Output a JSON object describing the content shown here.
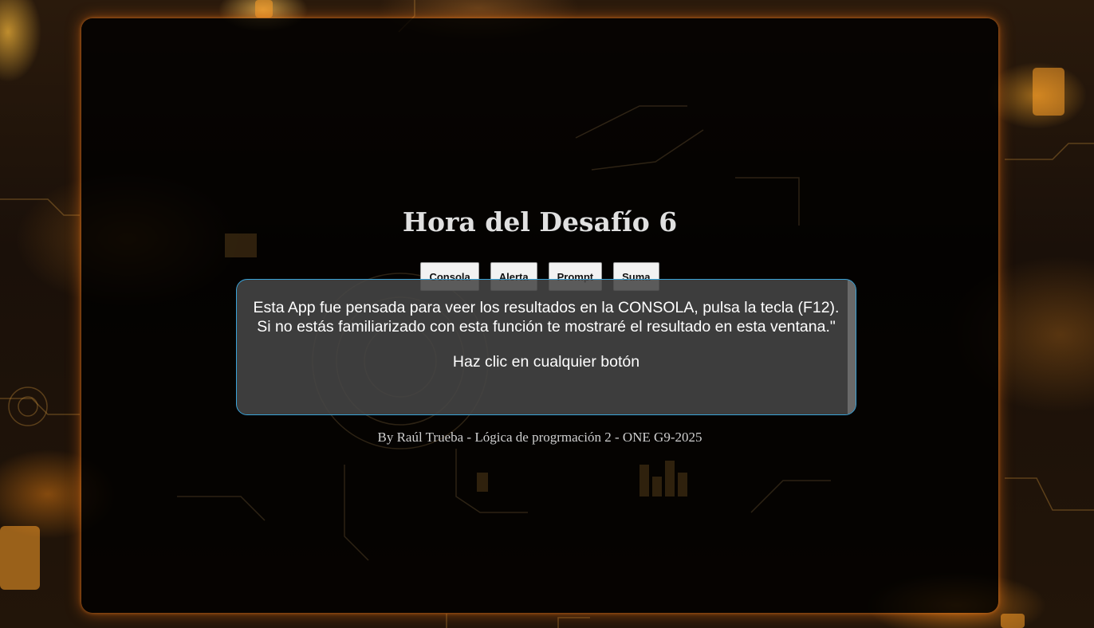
{
  "page": {
    "title": "Hora del Desafío 6",
    "buttons": [
      "Consola",
      "Alerta",
      "Prompt",
      "Suma"
    ],
    "output": {
      "line1": "Esta App fue pensada para veer los resultados en la CONSOLA, pulsa la tecla (F12).",
      "line2": "Si no estás familiarizado con esta función te mostraré el resultado en esta ventana.\"",
      "line3": "Haz clic en cualquier botón"
    },
    "footer": "By Raúl Trueba - Lógica de progrmación 2 - ONE G9-2025"
  },
  "colors": {
    "frame_glow": "#ff7814",
    "output_border": "#3aa3d8",
    "output_bg": "#464646",
    "title": "#e0e0e0"
  }
}
